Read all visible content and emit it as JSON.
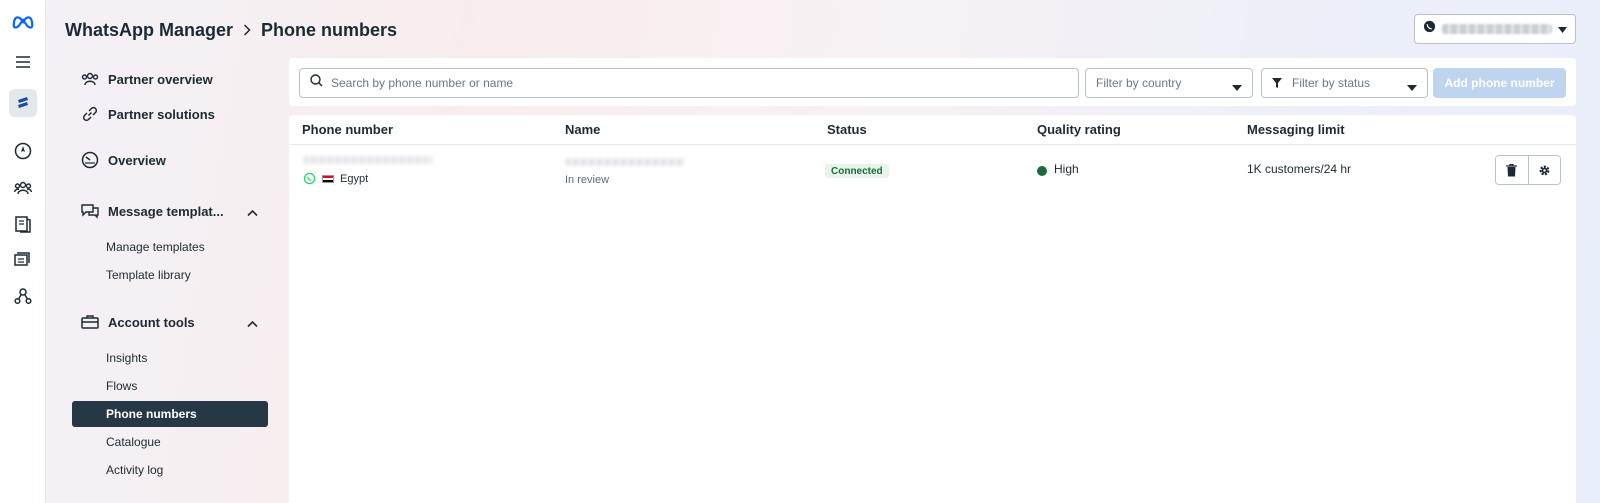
{
  "colors": {
    "accent": "#263746",
    "brand": "#0866ff",
    "status_connected": "#1e6b3a",
    "quality_high": "#1e6b3a",
    "add_button_disabled": "#bed4ef"
  },
  "rail": {
    "items": [
      {
        "icon": "meta-logo-icon"
      },
      {
        "icon": "menu-icon"
      },
      {
        "icon": "business-logo-icon"
      },
      {
        "icon": "compass-icon"
      },
      {
        "icon": "people-icon"
      },
      {
        "icon": "catalog-icon"
      },
      {
        "icon": "ads-icon"
      },
      {
        "icon": "network-icon"
      }
    ]
  },
  "header": {
    "breadcrumb_root": "WhatsApp Manager",
    "breadcrumb_page": "Phone numbers",
    "account_selector": {
      "icon": "whatsapp-icon"
    }
  },
  "nav": {
    "partner_overview": "Partner overview",
    "partner_solutions": "Partner solutions",
    "overview": "Overview",
    "message_templates": "Message templat...",
    "manage_templates": "Manage templates",
    "template_library": "Template library",
    "account_tools": "Account tools",
    "insights": "Insights",
    "flows": "Flows",
    "phone_numbers": "Phone numbers",
    "catalogue": "Catalogue",
    "activity_log": "Activity log"
  },
  "filters": {
    "search_placeholder": "Search by phone number or name",
    "country_placeholder": "Filter by country",
    "status_placeholder": "Filter by status",
    "add_button": "Add phone number"
  },
  "table": {
    "headers": [
      "Phone number",
      "Name",
      "Status",
      "Quality rating",
      "Messaging limit"
    ],
    "rows": [
      {
        "country": "Egypt",
        "name_status": "In review",
        "status": "Connected",
        "quality": "High",
        "messaging_limit": "1K customers/24 hr"
      }
    ]
  }
}
